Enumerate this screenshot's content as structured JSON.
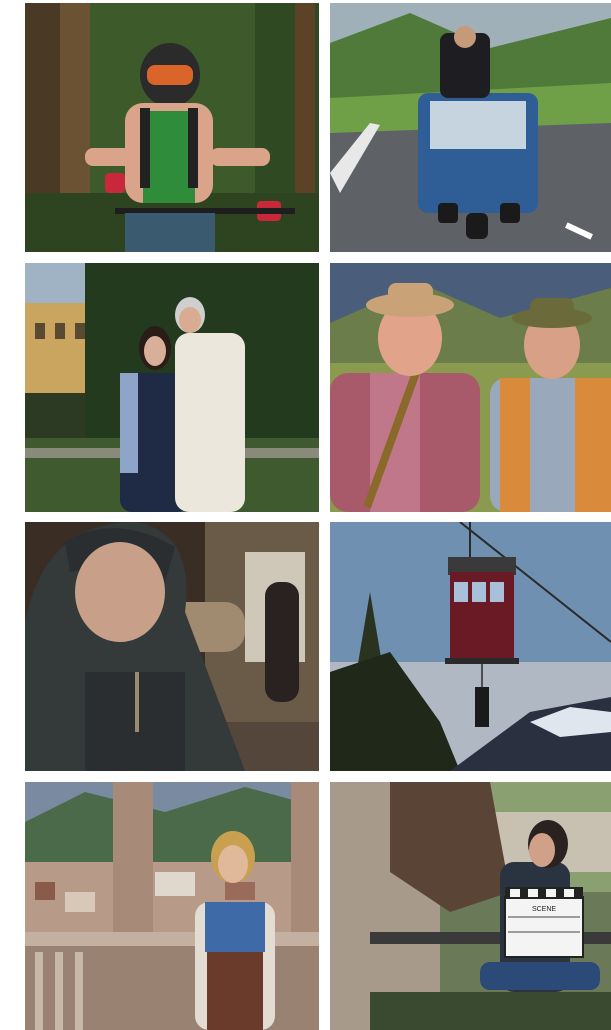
{
  "gallery": {
    "tiles": [
      {
        "subject": "mountain-biker-in-forest"
      },
      {
        "subject": "man-riding-blue-three-wheeler-on-mountain-road"
      },
      {
        "subject": "couple-in-front-of-villa"
      },
      {
        "subject": "two-older-men-in-hats"
      },
      {
        "subject": "hooded-man-in-dark-room"
      },
      {
        "subject": "cable-car-with-rappelling-person"
      },
      {
        "subject": "woman-on-balcony-over-town"
      },
      {
        "subject": "film-set-with-clapperboard"
      }
    ],
    "clapperboard_text": "SCENE"
  }
}
